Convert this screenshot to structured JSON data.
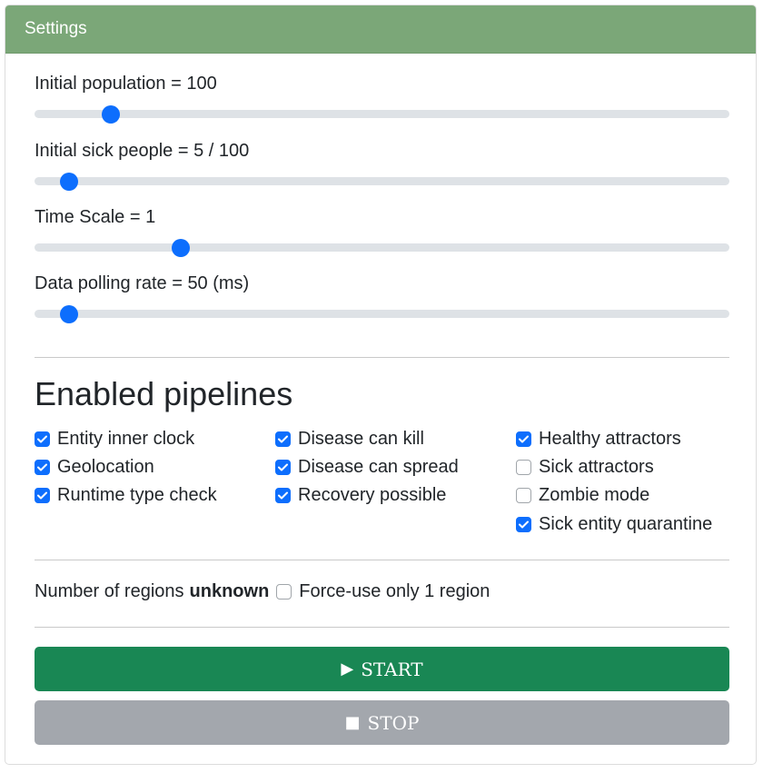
{
  "header": {
    "title": "Settings"
  },
  "sliders": [
    {
      "label": "Initial population = 100",
      "fraction": 0.11
    },
    {
      "label": "Initial sick people = 5 / 100",
      "fraction": 0.05
    },
    {
      "label": "Time Scale = 1",
      "fraction": 0.21
    },
    {
      "label": "Data polling rate = 50 (ms)",
      "fraction": 0.05
    }
  ],
  "pipelines": {
    "title": "Enabled pipelines",
    "items": [
      {
        "label": "Entity inner clock",
        "checked": true
      },
      {
        "label": "Geolocation",
        "checked": true
      },
      {
        "label": "Runtime type check",
        "checked": true
      },
      {
        "label": "Disease can kill",
        "checked": true
      },
      {
        "label": "Disease can spread",
        "checked": true
      },
      {
        "label": "Recovery possible",
        "checked": true
      },
      {
        "label": "Healthy attractors",
        "checked": true
      },
      {
        "label": "Sick attractors",
        "checked": false
      },
      {
        "label": "Zombie mode",
        "checked": false
      },
      {
        "label": "Sick entity quarantine",
        "checked": true
      }
    ]
  },
  "regions": {
    "label": "Number of regions",
    "value": "unknown",
    "force_label": "Force-use only 1 region",
    "force_checked": false
  },
  "buttons": {
    "start_icon": "▶",
    "start_label": "START",
    "stop_icon": "■",
    "stop_label": "STOP"
  },
  "colors": {
    "header_bg": "#7ba778",
    "accent": "#0d6efd",
    "start_bg": "#198754",
    "stop_bg": "#a3a7ad"
  },
  "icons": {
    "check": "check-icon",
    "play": "play-icon",
    "stop": "stop-icon"
  }
}
